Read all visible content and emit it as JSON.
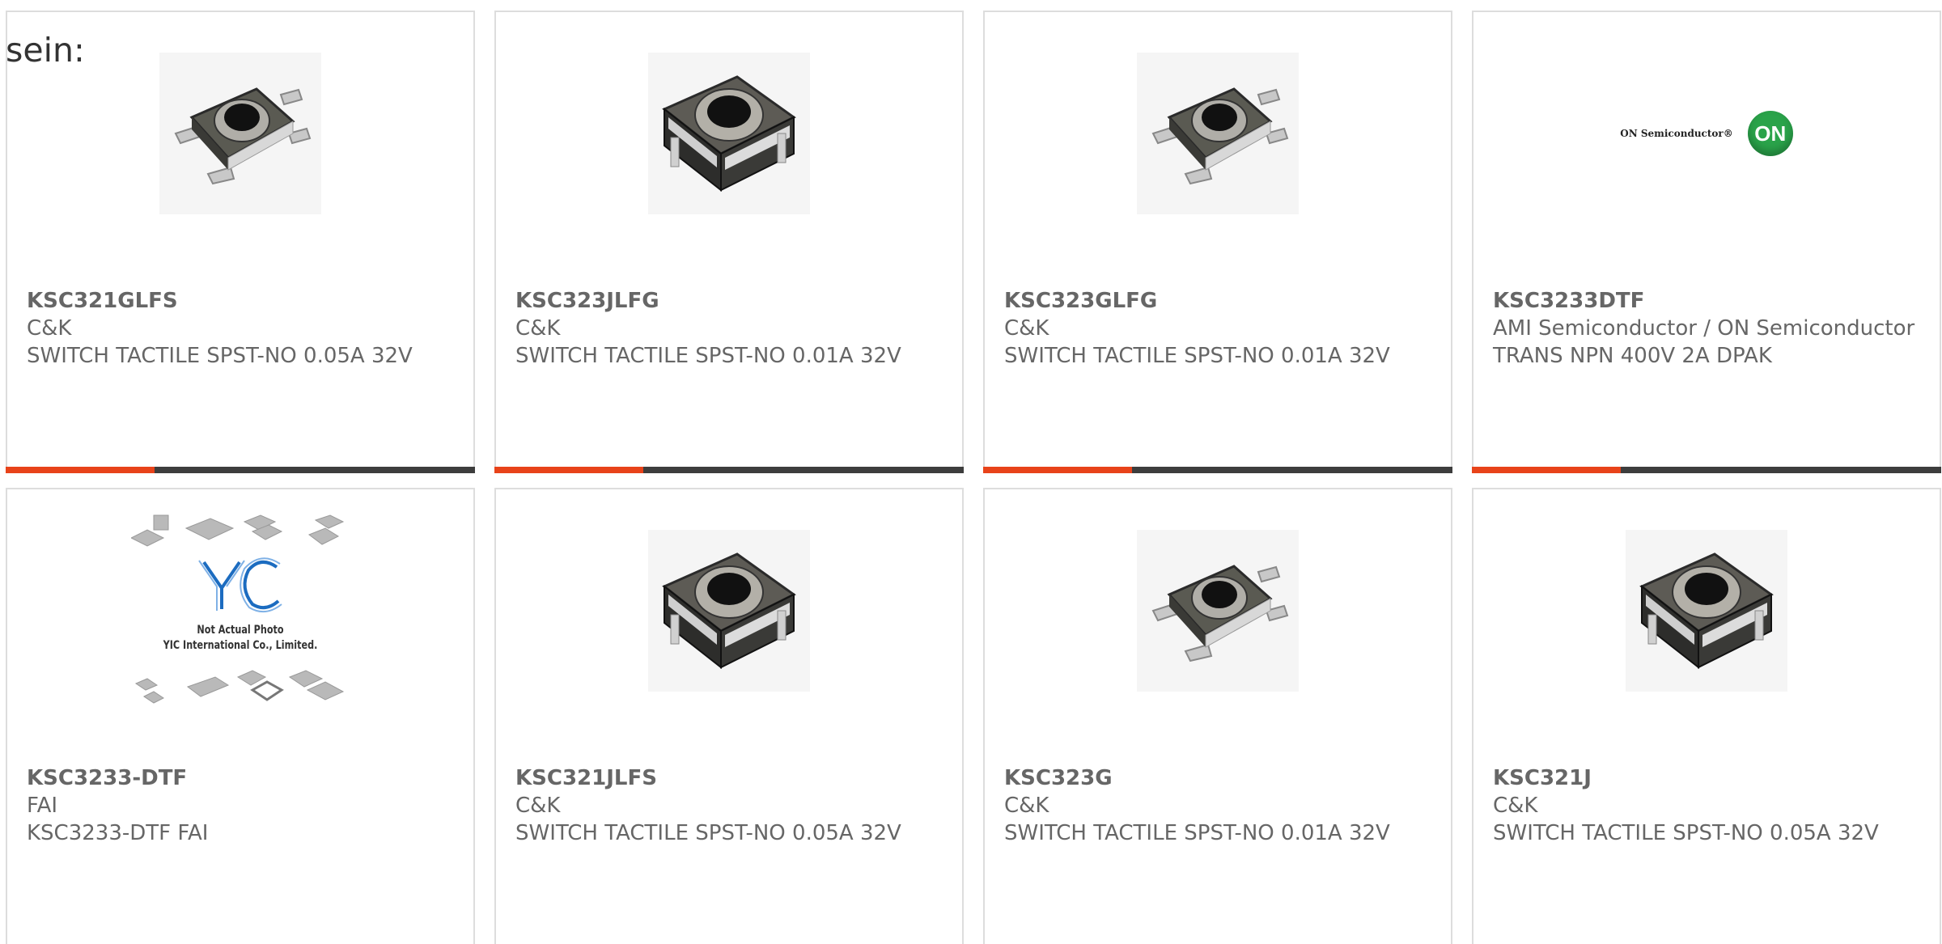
{
  "intro_text": "sein:",
  "colors": {
    "accent": "#e8431a",
    "bar": "#3d3d3d",
    "text": "#666666",
    "border": "#dddddd"
  },
  "products": [
    {
      "part": "KSC321GLFS",
      "maker": "C&K",
      "desc": "SWITCH TACTILE SPST-NO 0.05A 32V",
      "image": "tactile-switch-smd-icon"
    },
    {
      "part": "KSC323JLFG",
      "maker": "C&K",
      "desc": "SWITCH TACTILE SPST-NO 0.01A 32V",
      "image": "tactile-switch-jlead-icon"
    },
    {
      "part": "KSC323GLFG",
      "maker": "C&K",
      "desc": "SWITCH TACTILE SPST-NO 0.01A 32V",
      "image": "tactile-switch-smd-icon"
    },
    {
      "part": "KSC3233DTF",
      "maker": "AMI Semiconductor / ON Semiconductor",
      "desc": "TRANS NPN 400V 2A DPAK",
      "image": "on-semiconductor-logo",
      "logo_text": "ON Semiconductor®",
      "logo_badge": "ON"
    },
    {
      "part": "KSC3233-DTF",
      "maker": "FAI",
      "desc": "KSC3233-DTF FAI",
      "image": "not-actual-photo-placeholder",
      "placeholder_line1": "Not Actual Photo",
      "placeholder_line2": "YIC International Co., Limited."
    },
    {
      "part": "KSC321JLFS",
      "maker": "C&K",
      "desc": "SWITCH TACTILE SPST-NO 0.05A 32V",
      "image": "tactile-switch-jlead-icon"
    },
    {
      "part": "KSC323G",
      "maker": "C&K",
      "desc": "SWITCH TACTILE SPST-NO 0.01A 32V",
      "image": "tactile-switch-smd-icon"
    },
    {
      "part": "KSC321J",
      "maker": "C&K",
      "desc": "SWITCH TACTILE SPST-NO 0.05A 32V",
      "image": "tactile-switch-jlead-icon"
    }
  ]
}
